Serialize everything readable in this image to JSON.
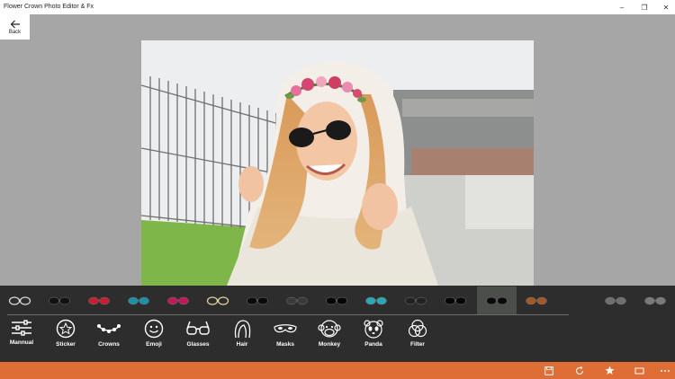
{
  "app": {
    "title": "Flower Crown Photo Editor & Fx"
  },
  "window_controls": {
    "minimize": "–",
    "maximize": "❐",
    "close": "✕"
  },
  "nav": {
    "back_label": "Back"
  },
  "glasses": [
    {
      "name": "glasses-thin-black",
      "color": "#dddddd"
    },
    {
      "name": "glasses-black-frame",
      "color": "#111111"
    },
    {
      "name": "glasses-red-heart",
      "color": "#c81e32"
    },
    {
      "name": "glasses-teal-aviator",
      "color": "#1d8fa6"
    },
    {
      "name": "glasses-pink-cat",
      "color": "#c0195a"
    },
    {
      "name": "glasses-gold-round",
      "color": "#e9d6a2"
    },
    {
      "name": "glasses-black-rect",
      "color": "#0a0a0a"
    },
    {
      "name": "glasses-dark-wire",
      "color": "#3a3a3a"
    },
    {
      "name": "glasses-black-wayfarer",
      "color": "#050505"
    },
    {
      "name": "glasses-teal-tint",
      "color": "#2aa6b5"
    },
    {
      "name": "glasses-dark-round",
      "color": "#222222"
    },
    {
      "name": "glasses-black-oval",
      "color": "#050505"
    },
    {
      "name": "glasses-round-black-selected",
      "color": "#0a0a0a"
    },
    {
      "name": "glasses-brown-tint",
      "color": "#a3582a"
    },
    {
      "name": "glasses-gray-shades",
      "color": "#6f6f6f"
    },
    {
      "name": "glasses-gray-aviator",
      "color": "#7a7a7a"
    }
  ],
  "tools": [
    {
      "label": "Mannual",
      "icon": "sliders-icon"
    },
    {
      "label": "Sticker",
      "icon": "star-badge-icon"
    },
    {
      "label": "Crowns",
      "icon": "crown-icon"
    },
    {
      "label": "Emoji",
      "icon": "emoji-icon"
    },
    {
      "label": "Glasses",
      "icon": "glasses-icon"
    },
    {
      "label": "Hair",
      "icon": "hair-icon"
    },
    {
      "label": "Masks",
      "icon": "mask-icon"
    },
    {
      "label": "Monkey",
      "icon": "monkey-icon"
    },
    {
      "label": "Panda",
      "icon": "panda-icon"
    },
    {
      "label": "Filter",
      "icon": "filter-icon"
    }
  ],
  "bottom_actions": [
    {
      "name": "save",
      "icon": "save-icon"
    },
    {
      "name": "rotate",
      "icon": "rotate-icon"
    },
    {
      "name": "favorite",
      "icon": "star-icon"
    },
    {
      "name": "crop",
      "icon": "crop-icon"
    },
    {
      "name": "more",
      "icon": "more-icon"
    }
  ],
  "colors": {
    "accent_bar": "#de6e36",
    "toolbar_bg": "#2d2d2d",
    "canvas_bg": "#a6a6a6"
  }
}
